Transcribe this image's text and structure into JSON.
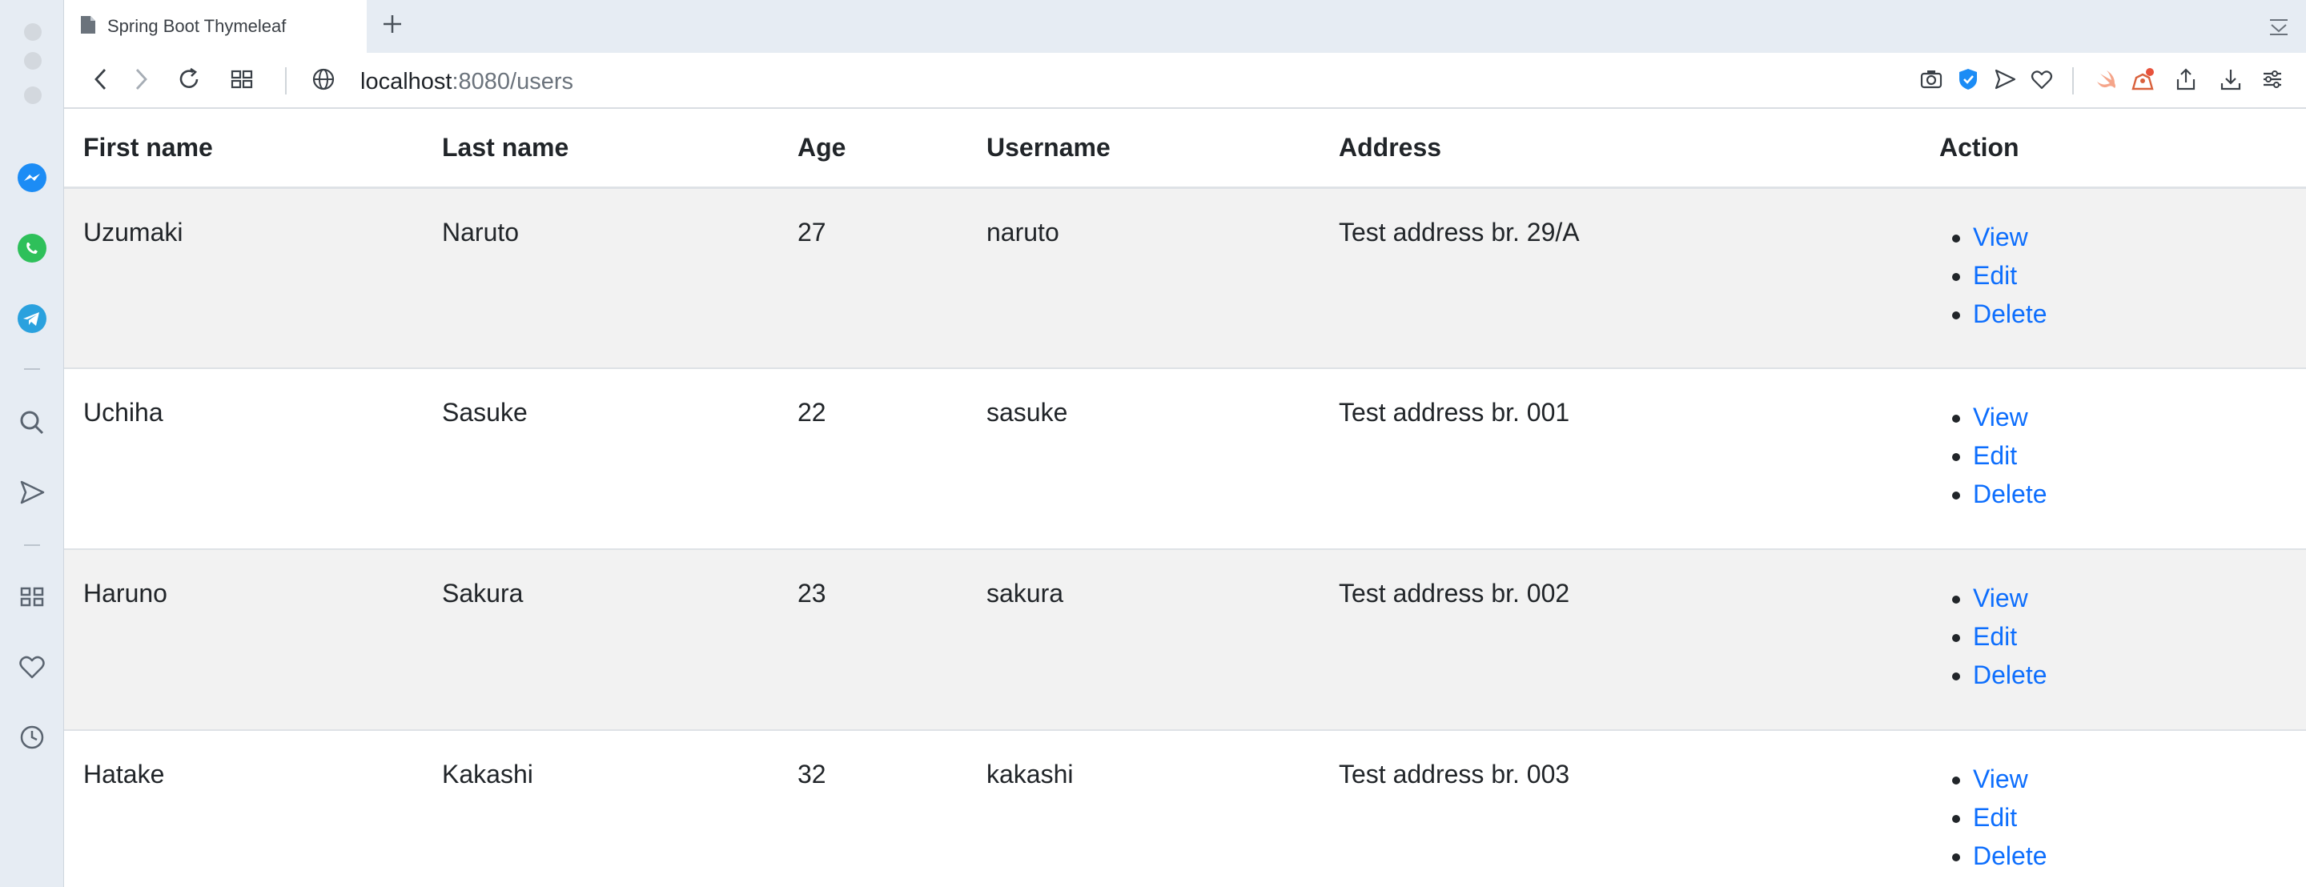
{
  "browser": {
    "tab_title": "Spring Boot Thymeleaf",
    "url_host": "localhost",
    "url_path": ":8080/users"
  },
  "sidebar_icons": [
    "messenger-icon",
    "whatsapp-icon",
    "telegram-icon",
    "search-icon",
    "send-icon",
    "grid-icon",
    "heart-icon",
    "history-icon"
  ],
  "table": {
    "headers": {
      "first_name": "First name",
      "last_name": "Last name",
      "age": "Age",
      "username": "Username",
      "address": "Address",
      "action": "Action"
    },
    "rows": [
      {
        "first_name": "Uzumaki",
        "last_name": "Naruto",
        "age": "27",
        "username": "naruto",
        "address": "Test address br. 29/A"
      },
      {
        "first_name": "Uchiha",
        "last_name": "Sasuke",
        "age": "22",
        "username": "sasuke",
        "address": "Test address br. 001"
      },
      {
        "first_name": "Haruno",
        "last_name": "Sakura",
        "age": "23",
        "username": "sakura",
        "address": "Test address br. 002"
      },
      {
        "first_name": "Hatake",
        "last_name": "Kakashi",
        "age": "32",
        "username": "kakashi",
        "address": "Test address br. 003"
      }
    ],
    "actions": {
      "view": "View",
      "edit": "Edit",
      "delete": "Delete"
    }
  },
  "colors": {
    "link": "#0d6efd",
    "stripe": "#f2f2f2",
    "chrome": "#e6ecf3"
  }
}
